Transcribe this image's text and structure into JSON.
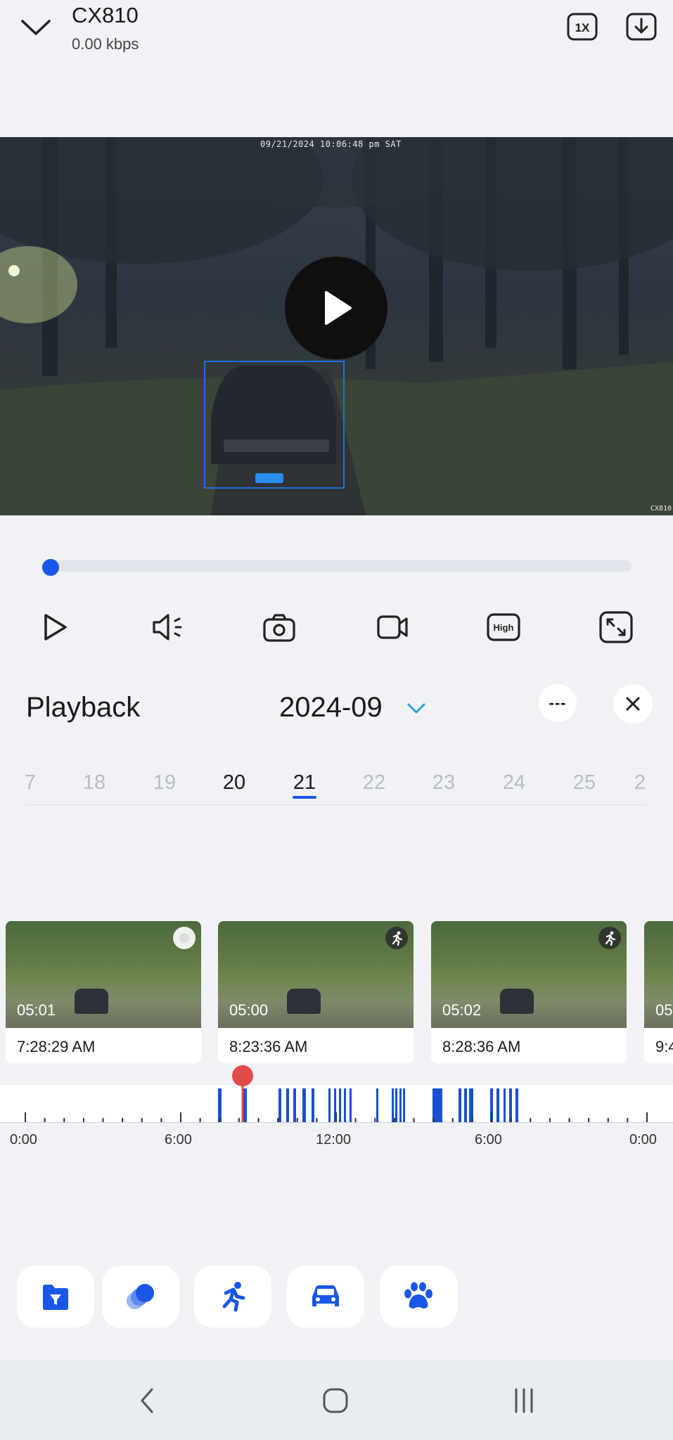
{
  "header": {
    "device_name": "CX810",
    "bitrate": "0.00 kbps",
    "icons": [
      "chevron-down-icon",
      "speed-1x-icon",
      "download-icon"
    ]
  },
  "video": {
    "overlay_timestamp": "09/21/2024 10:06:48 pm SAT",
    "overlay_camera": "CX810",
    "detection_color": "#1e6fe0"
  },
  "controls": {
    "progress": 0,
    "icons": [
      "play-icon",
      "volume-icon",
      "snapshot-icon",
      "record-icon",
      "quality-high-icon",
      "fullscreen-icon"
    ],
    "quality_label": "High"
  },
  "playback": {
    "title": "Playback",
    "month": "2024-09",
    "more_label": "---",
    "days": [
      "7",
      "18",
      "19",
      "20",
      "21",
      "22",
      "23",
      "24",
      "25",
      "2"
    ],
    "selected_day": "21"
  },
  "events": [
    {
      "duration": "05:01",
      "time": "7:28:29 AM",
      "badge": "motion-icon"
    },
    {
      "duration": "05:00",
      "time": "8:23:36 AM",
      "badge": "motion-icon"
    },
    {
      "duration": "05:02",
      "time": "8:28:36 AM",
      "badge": "motion-icon"
    },
    {
      "duration": "05",
      "time": "9:4",
      "badge": "motion-icon"
    }
  ],
  "timeline": {
    "labels": [
      "0:00",
      "6:00",
      "12:00",
      "6:00",
      "0:00"
    ],
    "accent": "#1a4fd0",
    "cursor_color": "#e24b4b"
  },
  "filters": [
    "file-icon",
    "all-events-icon",
    "person-icon",
    "vehicle-icon",
    "pet-icon"
  ],
  "accent_color": "#1a56e8"
}
